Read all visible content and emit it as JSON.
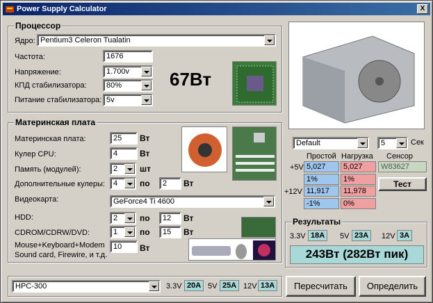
{
  "window": {
    "title": "Power Supply Calculator",
    "close": "X"
  },
  "cpu": {
    "title": "Процессор",
    "core_label": "Ядро:",
    "core_value": "Pentium3 Celeron Tualatin",
    "freq_label": "Частота:",
    "freq_value": "1676",
    "volt_label": "Напряжение:",
    "volt_value": "1.700v",
    "eff_label": "КПД стабилизатора:",
    "eff_value": "80%",
    "supply_label": "Питание стабилизатора:",
    "supply_value": "5v",
    "power": "67Вт"
  },
  "board": {
    "title": "Материнская плата",
    "mb_label": "Материнская плата:",
    "mb_value": "25",
    "unit_w": "Вт",
    "cooler_label": "Кулер CPU:",
    "cooler_value": "4",
    "mem_label": "Память (модулей):",
    "mem_value": "2",
    "unit_pcs": "шт",
    "fans_label": "Дополнительные кулеры:",
    "fans_value": "4",
    "per": "по",
    "fans_w": "2",
    "video_label": "Видеокарта:",
    "video_value": "GeForce4 Ti 4600",
    "hdd_label": "HDD:",
    "hdd_value": "2",
    "hdd_w": "12",
    "cd_label": "CDROM/CDRW/DVD:",
    "cd_value": "1",
    "cd_w": "15",
    "misc_label1": "Mouse+Keyboard+Modem",
    "misc_label2": "Sound card, Firewire, и т.д.",
    "misc_value": "10"
  },
  "sensor": {
    "profile": "Default",
    "interval": "5",
    "interval_unit": "Сек",
    "col_idle": "Простой",
    "col_load": "Нагрузка",
    "col_sensor": "Сенсор",
    "r5v": "+5V",
    "idle5": "5,027",
    "load5": "5,027",
    "sensor_name": "W83627",
    "idle5p": "1%",
    "load5p": "1%",
    "r12v": "+12V",
    "idle12": "11,917",
    "load12": "11,978",
    "idle12p": "-1%",
    "load12p": "0%",
    "test": "Тест"
  },
  "results": {
    "title": "Результаты",
    "l33": "3.3V",
    "a33": "18A",
    "l5": "5V",
    "a5": "23A",
    "l12": "12V",
    "a12": "3A",
    "total": "243Вт (282Вт пик)"
  },
  "bottom": {
    "psu": "HPC-300",
    "l33": "3.3V",
    "a33": "20A",
    "l5": "5V",
    "a5": "25A",
    "l12": "12V",
    "a12": "13A",
    "recalc": "Пересчитать",
    "detect": "Определить"
  },
  "colors": {
    "title_start": "#0a246a",
    "title_end": "#3a6ea5",
    "idle_bg": "#9fc7ee",
    "load_bg": "#f0a0a0",
    "amp_bg": "#a8d8d8"
  }
}
